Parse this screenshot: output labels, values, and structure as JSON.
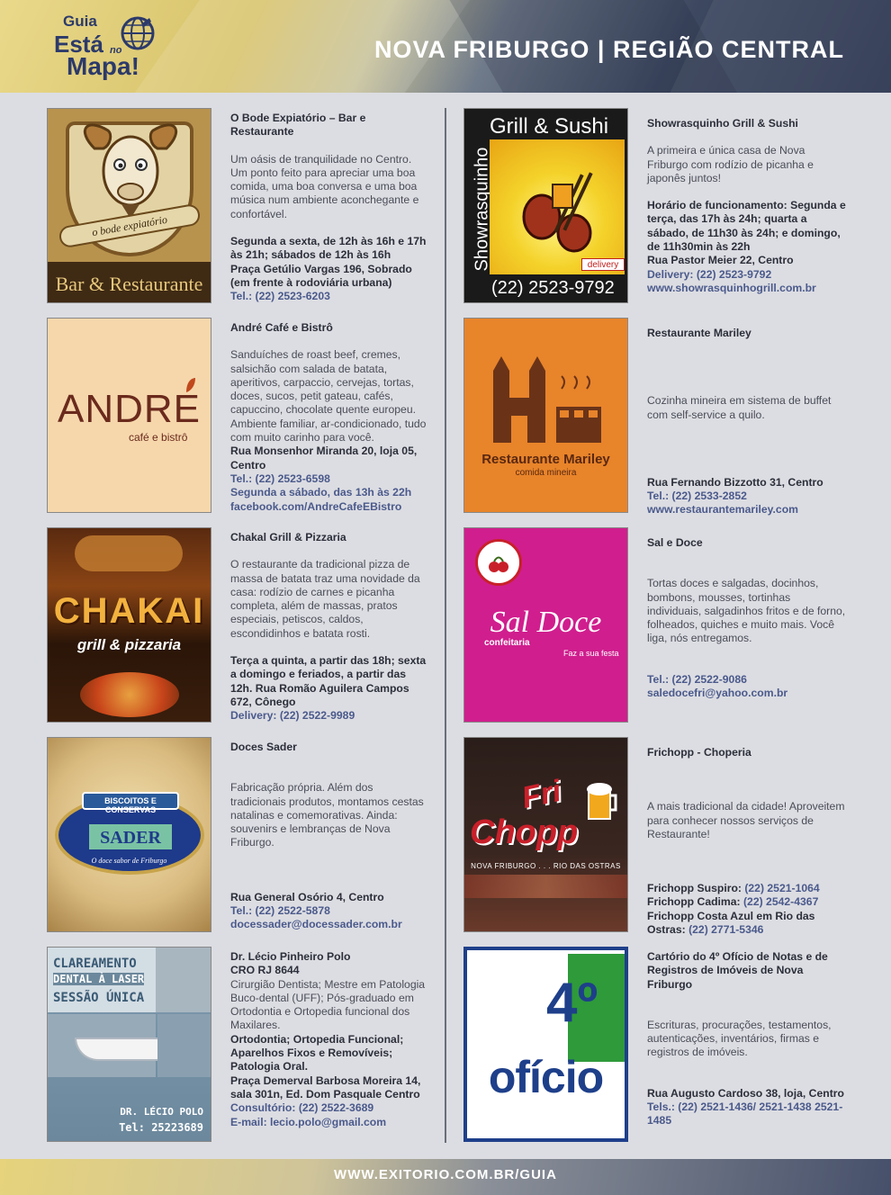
{
  "header": {
    "logo_guia": "Guia",
    "logo_esta": "Está",
    "logo_no": "no",
    "logo_mapa": "Mapa!",
    "title": "NOVA FRIBURGO | REGIÃO CENTRAL"
  },
  "colors": {
    "accent_link": "#4b5a8c",
    "header_dark": "#2c3650",
    "header_gold": "#e9d98a"
  },
  "left": [
    {
      "thumb": {
        "top": "o bode expiatório",
        "bottom": "Bar & Restaurante"
      },
      "name": "O Bode Expiatório – Bar e Restaurante",
      "desc": "Um oásis de tranquilidade no Centro. Um ponto feito para apreciar uma boa comida, uma boa conversa e uma boa música num ambiente aconchegante e confortável.",
      "hours": "Segunda a sexta, de 12h às 16h e 17h às 21h; sábados de 12h às 16h",
      "address": "Praça Getúlio Vargas 196, Sobrado (em frente à rodoviária urbana)",
      "tel": "Tel.: (22) 2523-6203"
    },
    {
      "thumb": {
        "title": "ANDRE",
        "sub": "café e bistrô"
      },
      "name": "André Café e Bistrô",
      "desc": "Sanduíches de roast beef, cremes, salsichão com salada de batata, aperitivos, carpaccio, cervejas, tortas, doces, sucos, petit gateau, cafés, capuccino, chocolate quente europeu. Ambiente familiar, ar-condicionado, tudo com muito carinho para você.",
      "address": "Rua Monsenhor Miranda 20, loja 05, Centro",
      "tel": "Tel.: (22) 2523-6598",
      "hours": "Segunda a sábado, das 13h às 22h",
      "web": "facebook.com/AndreCafeEBistro"
    },
    {
      "thumb": {
        "title": "CHAKAI",
        "sub": "grill & pizzaria"
      },
      "name": "Chakal Grill & Pizzaria",
      "desc": "O restaurante da tradicional pizza de massa de batata traz uma novidade da casa: rodízio de carnes e picanha completa, além de massas, pratos especiais, petiscos, caldos, escondidinhos e batata rosti.",
      "hours": "Terça a quinta, a partir das 18h; sexta a domingo e feriados, a partir das 12h. Rua Romão Aguilera Campos 672, Cônego",
      "tel": "Delivery: (22) 2522-9989"
    },
    {
      "thumb": {
        "arc": "BISCOITOS E CONSERVAS",
        "title": "SADER",
        "sub": "O doce sabor de Friburgo"
      },
      "name": "Doces Sader",
      "desc": "Fabricação própria. Além dos tradicionais produtos, montamos cestas natalinas e comemorativas. Ainda: souvenirs e lembranças de Nova Friburgo.",
      "address": "Rua General Osório 4, Centro",
      "tel": "Tel.: (22) 2522-5878",
      "web": "docessader@docessader.com.br"
    },
    {
      "thumb": {
        "line1": "CLAREAMENTO",
        "line2": "DENTAL À LASER",
        "line3": "SESSÃO ÚNICA",
        "doc": "DR. LÉCIO POLO",
        "phone": "Tel: 25223689"
      },
      "name": "Dr. Lécio Pinheiro Polo",
      "cro": "CRO RJ 8644",
      "desc": "Cirurgião Dentista; Mestre em Patologia Buco-dental (UFF); Pós-graduado em Ortodontia e Ortopedia funcional dos Maxilares.",
      "specialties": "Ortodontia; Ortopedia Funcional; Aparelhos Fixos e Removíveis; Patologia Oral.",
      "address": "Praça Demerval Barbosa Moreira 14, sala 301n, Ed. Dom Pasquale Centro",
      "tel": "Consultório: (22) 2522-3689",
      "web": "E-mail: lecio.polo@gmail.com"
    }
  ],
  "right": [
    {
      "thumb": {
        "title": "Grill & Sushi",
        "side": "Showrasquinho",
        "phone": "(22) 2523-9792",
        "badge": "delivery"
      },
      "name": "Showrasquinho Grill & Sushi",
      "desc": "A primeira e única casa de Nova Friburgo com rodízio de picanha e japonês juntos!",
      "hours": "Horário de funcionamento: Segunda e terça, das 17h às 24h; quarta a sábado, de 11h30 às 24h; e domingo, de 11h30min às 22h",
      "address": "Rua Pastor Meier 22, Centro",
      "tel": "Delivery: (22) 2523-9792",
      "web": "www.showrasquinhogrill.com.br"
    },
    {
      "thumb": {
        "title": "Restaurante Mariley",
        "sub": "comida mineira"
      },
      "name": "Restaurante Mariley",
      "desc": "Cozinha mineira em sistema de buffet com self-service a quilo.",
      "address": "Rua Fernando Bizzotto 31, Centro",
      "tel": "Tel.: (22) 2533-2852",
      "web": "www.restaurantemariley.com"
    },
    {
      "thumb": {
        "title": "Sal Doce",
        "sub": "confeitaria",
        "tagline": "Faz a sua festa"
      },
      "name": "Sal e Doce",
      "desc": "Tortas doces e salgadas, docinhos, bombons, mousses, tortinhas individuais, salgadinhos fritos e de forno, folheados, quiches e muito mais. Você liga, nós entregamos.",
      "tel": "Tel.: (22) 2522-9086",
      "web": "saledocefri@yahoo.com.br"
    },
    {
      "thumb": {
        "title1": "Fri",
        "title2": "Chopp",
        "sub": "NOVA FRIBURGO . . . RIO DAS OSTRAS"
      },
      "name": "Frichopp - Choperia",
      "desc": "A mais tradicional da cidade! Aproveitem para conhecer nossos serviços de Restaurante!",
      "lines": [
        {
          "label": "Frichopp Suspiro:",
          "tel": "(22) 2521-1064"
        },
        {
          "label": "Frichopp Cadima:",
          "tel": "(22) 2542-4367"
        },
        {
          "label": "Frichopp Costa Azul em Rio das Ostras:",
          "tel": "(22) 2771-5346"
        }
      ]
    },
    {
      "thumb": {
        "num": "4º",
        "word": "ofício"
      },
      "name": "Cartório do 4º Ofício de Notas e de Registros de Imóveis de Nova Friburgo",
      "desc": "Escrituras, procurações, testamentos, autenticações, inventários, firmas e registros de imóveis.",
      "address": "Rua Augusto Cardoso 38, loja, Centro",
      "tel": "Tels.: (22) 2521-1436/ 2521-1438 2521-1485"
    }
  ],
  "footer": {
    "url": "WWW.EXITORIO.COM.BR/GUIA"
  }
}
